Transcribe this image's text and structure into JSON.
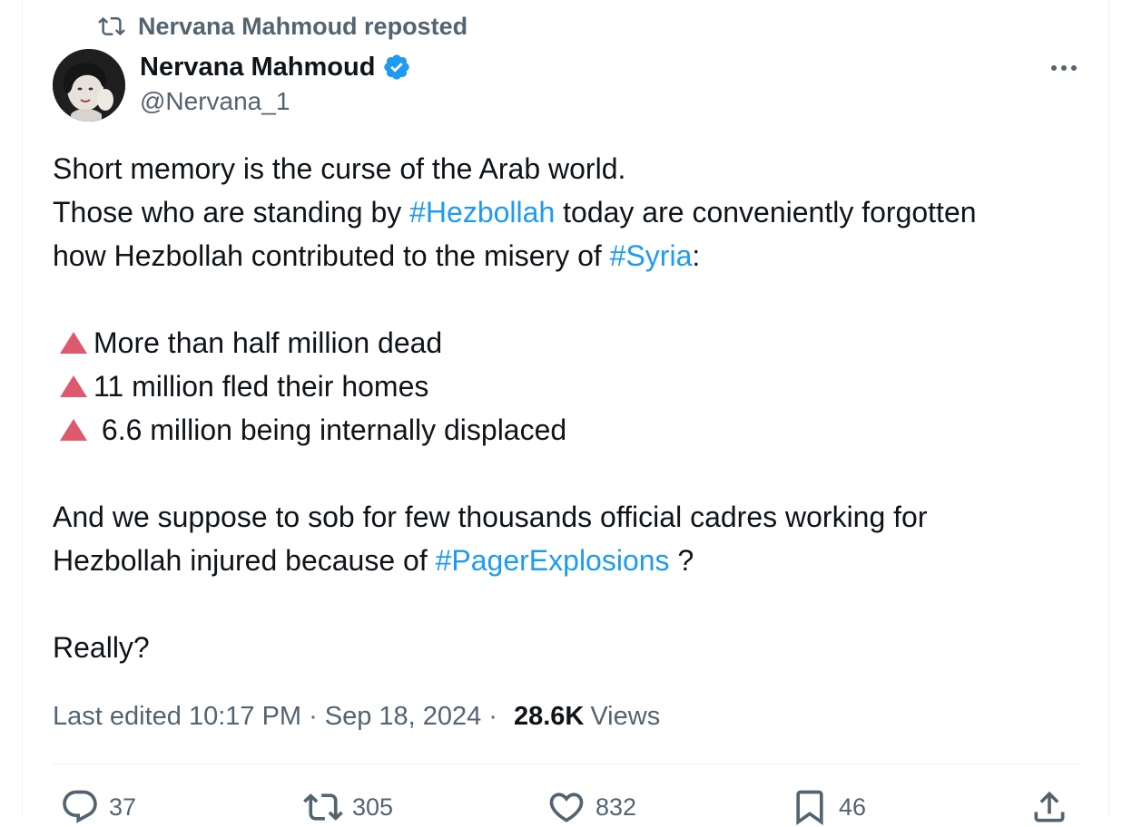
{
  "repost": {
    "label": "Nervana Mahmoud reposted",
    "icon": "repost-icon"
  },
  "author": {
    "name": "Nervana Mahmoud",
    "handle": "@Nervana_1",
    "verified_icon": "verified-badge-icon"
  },
  "tweet": {
    "line1": "Short memory is the curse of the Arab world.",
    "line2_before": "Those who are standing by ",
    "line2_tag": "#Hezbollah",
    "line2_after": " today are conveniently forgotten",
    "line3_before": "how Hezbollah contributed to the misery of ",
    "line3_tag": "#Syria",
    "line3_after": ":",
    "bullets": [
      "More than half million dead",
      "11 million fled their homes",
      " 6.6 million being internally displaced"
    ],
    "line4": "And we suppose to sob for few thousands official cadres working for",
    "line5_before": "Hezbollah injured because of ",
    "line5_tag": "#PagerExplosions",
    "line5_after": " ?",
    "line6": "Really?"
  },
  "meta": {
    "edited": "Last edited 10:17 PM",
    "date": "Sep 18, 2024",
    "separator": "·",
    "views_count": "28.6K",
    "views_label": "Views"
  },
  "actions": {
    "replies": "37",
    "reposts": "305",
    "likes": "832",
    "bookmarks": "46"
  },
  "colors": {
    "link": "#1d9bf0",
    "secondary_text": "#536471",
    "bullet_triangle": "#dd5a6e"
  }
}
